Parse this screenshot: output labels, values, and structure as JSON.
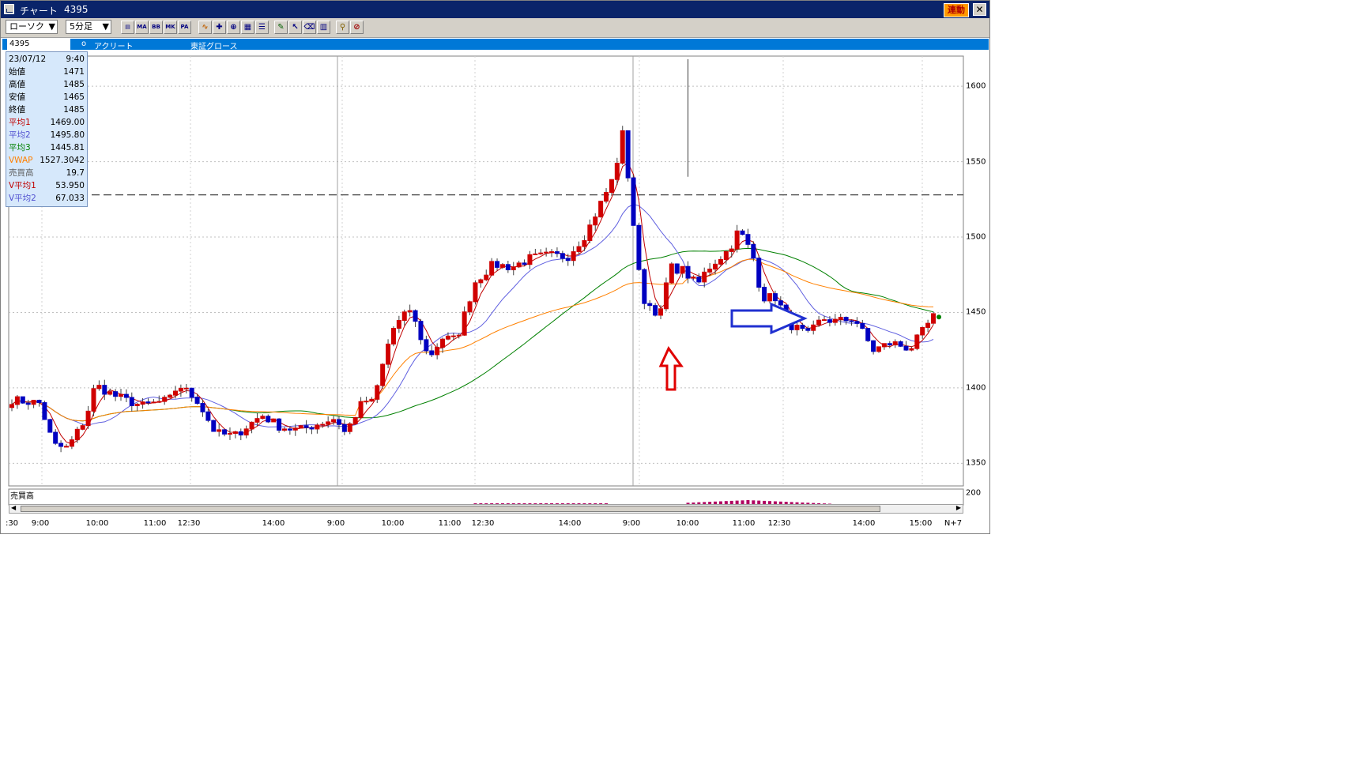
{
  "window": {
    "title": "チャート",
    "code_title": "4395",
    "renko_label": "連動",
    "close_glyph": "✕"
  },
  "toolbar": {
    "chart_type": "ローソク",
    "interval": "5分足",
    "buttons": [
      "candle-icon",
      "ma-icon",
      "bb-icon",
      "mk-icon",
      "pa-icon",
      "line-icon",
      "cross-icon",
      "zoom-icon",
      "grid-icon",
      "list-icon",
      "pen-icon",
      "cursor-icon",
      "eraser-icon",
      "trash-icon",
      "search-icon",
      "erase-line-icon"
    ],
    "button_text": {
      "ma": "MA",
      "bb": "BB",
      "mk": "MK",
      "pa": "PA"
    }
  },
  "infobar": {
    "code": "4395",
    "separator": "o",
    "name": "アクリート",
    "market": "東証グロース"
  },
  "datapanel": {
    "date": "23/07/12",
    "time": "9:40",
    "rows": [
      {
        "label": "始値",
        "value": "1471",
        "color": "#000000"
      },
      {
        "label": "高値",
        "value": "1485",
        "color": "#000000"
      },
      {
        "label": "安値",
        "value": "1465",
        "color": "#000000"
      },
      {
        "label": "終値",
        "value": "1485",
        "color": "#000000"
      },
      {
        "label": "平均1",
        "value": "1469.00",
        "color": "#c00000"
      },
      {
        "label": "平均2",
        "value": "1495.80",
        "color": "#5050d0"
      },
      {
        "label": "平均3",
        "value": "1445.81",
        "color": "#008000"
      },
      {
        "label": "VWAP",
        "value": "1527.3042",
        "color": "#ff8000"
      },
      {
        "label": "売買高",
        "value": "19.7",
        "color": "#606060"
      },
      {
        "label": "V平均1",
        "value": "53.950",
        "color": "#c00000"
      },
      {
        "label": "V平均2",
        "value": "67.033",
        "color": "#5050d0"
      }
    ]
  },
  "chart_data": {
    "type": "candlestick",
    "ylim": [
      1335,
      1620
    ],
    "y_ticks": [
      1600,
      1550,
      1500,
      1450,
      1400,
      1350
    ],
    "vwap_dashed_level": 1528,
    "volume_label": "売買高",
    "volume_tick": "200",
    "x_labels": [
      ":30",
      "9:00",
      "10:00",
      "11:00",
      "12:30",
      "14:00",
      "9:00",
      "10:00",
      "11:00",
      "12:30",
      "14:00",
      "9:00",
      "10:00",
      "11:00",
      "12:30",
      "14:00",
      "15:00",
      "N+7"
    ],
    "colors": {
      "up": "#d00000",
      "down": "#0000c0",
      "ma1": "#c00000",
      "ma2": "#6060e0",
      "ma3": "#008000",
      "vwap": "#ff8000"
    },
    "day3_close": 1447,
    "annotations": {
      "red_arrow": "up",
      "blue_arrow": "right"
    }
  }
}
